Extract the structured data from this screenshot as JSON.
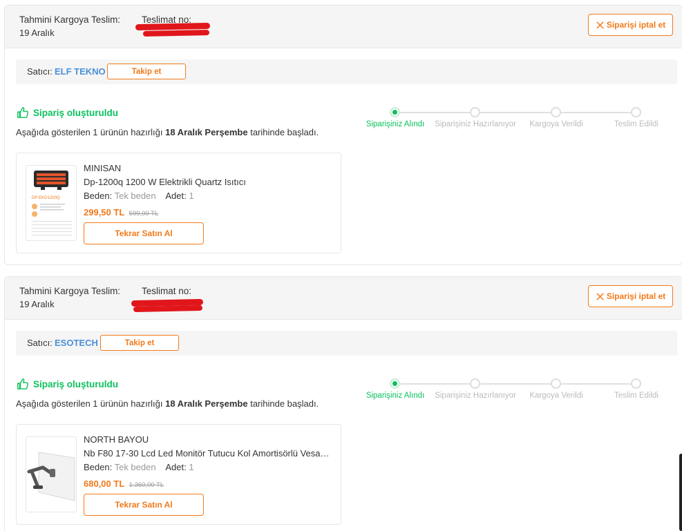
{
  "orders": [
    {
      "eta_label": "Tahmini Kargoya Teslim:",
      "eta_value": "19 Aralık",
      "tracking_label": "Teslimat no:",
      "cancel_label": "Siparişi iptal et",
      "seller_label": "Satıcı:",
      "seller_name": "ELF TEKNO",
      "follow_label": "Takip et",
      "status_title": "Sipariş oluşturuldu",
      "status_desc_pre": "Aşağıda gösterilen 1 ürünün hazırlığı",
      "status_desc_date": "18 Aralık Perşembe",
      "status_desc_post": "tarihinde başladı.",
      "steps": [
        "Siparişiniz Alındı",
        "Siparişiniz Hazırlanıyor",
        "Kargoya Verildi",
        "Teslim Edildi"
      ],
      "active_step": 0,
      "product": {
        "brand": "MINISAN",
        "name": "Dp-1200q 1200 W Elektrikli Quartz Isıtıcı",
        "size_label": "Beden:",
        "size_value": "Tek beden",
        "qty_label": "Adet:",
        "qty_value": "1",
        "price": "299,50 TL",
        "old_price": "599,00 TL",
        "rebuy_label": "Tekrar Satın Al",
        "thumb_text": "DP EKO1200Q"
      }
    },
    {
      "eta_label": "Tahmini Kargoya Teslim:",
      "eta_value": "19 Aralık",
      "tracking_label": "Teslimat no:",
      "cancel_label": "Siparişi iptal et",
      "seller_label": "Satıcı:",
      "seller_name": "ESOTECH",
      "follow_label": "Takip et",
      "status_title": "Sipariş oluşturuldu",
      "status_desc_pre": "Aşağıda gösterilen 1 ürünün hazırlığı",
      "status_desc_date": "18 Aralık Perşembe",
      "status_desc_post": "tarihinde başladı.",
      "steps": [
        "Siparişiniz Alındı",
        "Siparişiniz Hazırlanıyor",
        "Kargoya Verildi",
        "Teslim Edildi"
      ],
      "active_step": 0,
      "product": {
        "brand": "NORTH BAYOU",
        "name": "Nb F80 17-30 Lcd Led Monitör Tutucu Kol Amortisörlü Vesa…",
        "size_label": "Beden:",
        "size_value": "Tek beden",
        "qty_label": "Adet:",
        "qty_value": "1",
        "price": "680,00 TL",
        "old_price": "1.360,00 TL",
        "rebuy_label": "Tekrar Satın Al"
      }
    }
  ],
  "colors": {
    "accent": "#f27a1a",
    "success": "#0bc15c",
    "seller_link": "#4a90d9",
    "redaction": "#e1161b"
  }
}
